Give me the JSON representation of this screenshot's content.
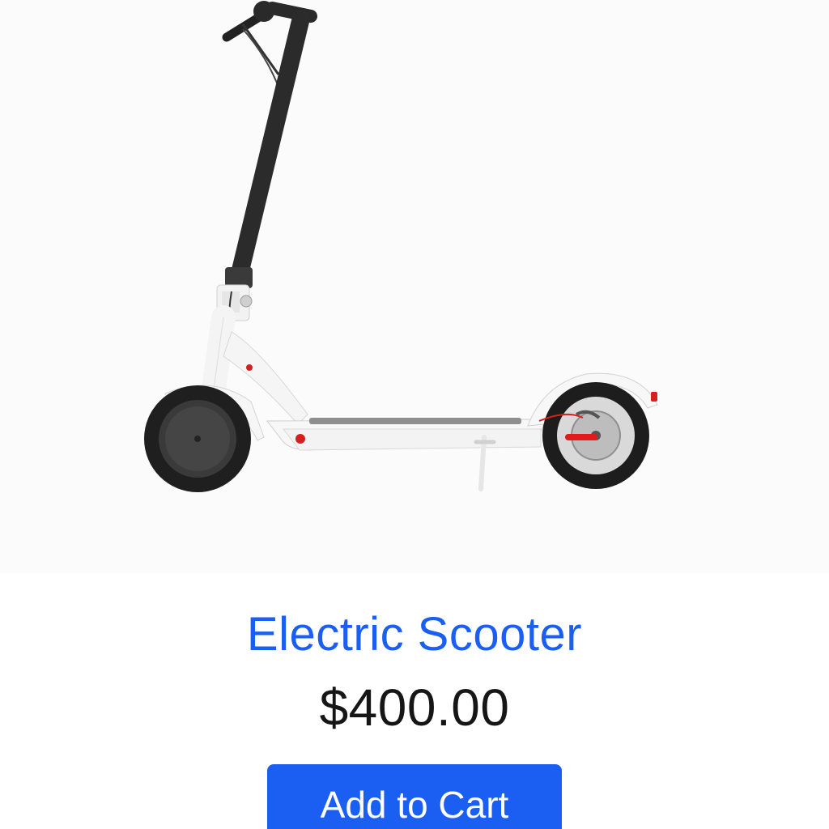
{
  "product": {
    "name": "Electric Scooter",
    "price": "$400.00",
    "image_icon": "electric-scooter-image"
  },
  "actions": {
    "add_to_cart_label": "Add to Cart"
  },
  "colors": {
    "accent": "#1a5ff2",
    "button": "#1a5ff2",
    "price_text": "#161616",
    "image_background": "#fbfbfb"
  }
}
